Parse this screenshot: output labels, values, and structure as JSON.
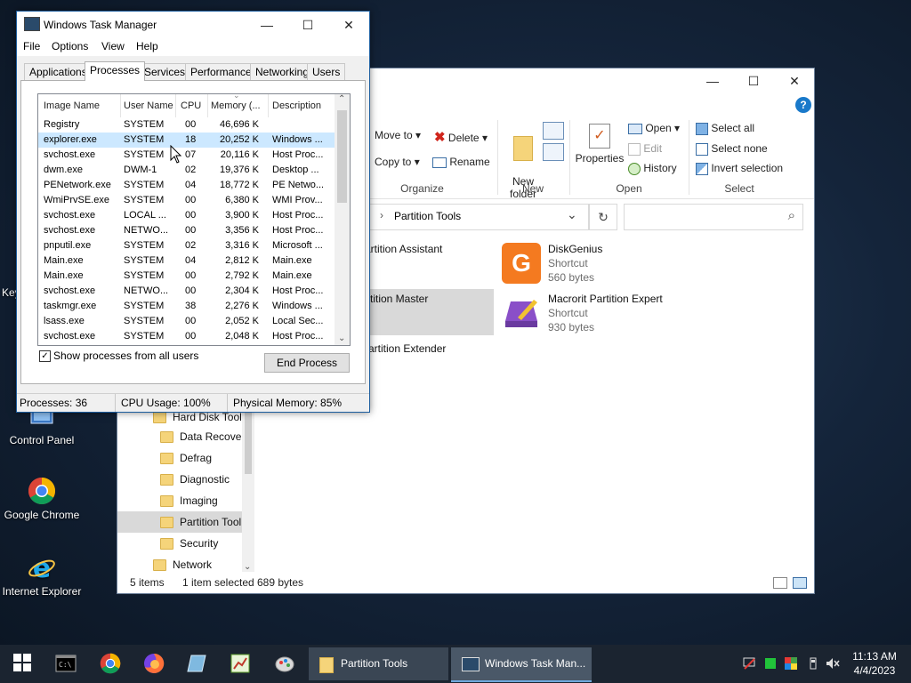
{
  "desktop": {
    "partial_label": "Key",
    "icons": [
      {
        "label": "Control Panel",
        "icon": "control-panel-icon"
      },
      {
        "label": "Google Chrome",
        "icon": "chrome-icon"
      },
      {
        "label": "Internet Explorer",
        "icon": "internet-explorer-icon"
      }
    ]
  },
  "explorer": {
    "window_controls": {
      "minimize": "—",
      "maximize": "☐",
      "close": "✕"
    },
    "ribbon": {
      "organize": {
        "move_to": "Move to ▾",
        "delete": "Delete ▾",
        "copy_to": "Copy to ▾",
        "rename": "Rename",
        "label": "Organize"
      },
      "new": {
        "new_folder": "New\nfolder",
        "label": "New"
      },
      "open": {
        "properties": "Properties",
        "open": "Open ▾",
        "edit": "Edit",
        "history": "History",
        "label": "Open"
      },
      "select": {
        "select_all": "Select all",
        "select_none": "Select none",
        "invert": "Invert selection",
        "label": "Select"
      }
    },
    "address": {
      "path_sep": "›",
      "path": "Partition Tools",
      "dropdown": "⌄",
      "refresh": "↻"
    },
    "search_icon": "⌕",
    "nav_tree": [
      {
        "label": "Hard Disk Tools",
        "indent": 0,
        "selected": false
      },
      {
        "label": "Data Recover",
        "indent": 1,
        "selected": false
      },
      {
        "label": "Defrag",
        "indent": 1,
        "selected": false
      },
      {
        "label": "Diagnostic",
        "indent": 1,
        "selected": false
      },
      {
        "label": "Imaging",
        "indent": 1,
        "selected": false
      },
      {
        "label": "Partition Tool",
        "indent": 1,
        "selected": true
      },
      {
        "label": "Security",
        "indent": 1,
        "selected": false
      },
      {
        "label": "Network",
        "indent": 0,
        "selected": false
      }
    ],
    "files": [
      {
        "name": "artition Assistant",
        "sub1": "",
        "sub2": ""
      },
      {
        "name": "DiskGenius",
        "sub1": "Shortcut",
        "sub2": "560 bytes"
      },
      {
        "name": "rtition Master",
        "sub1": "",
        "sub2": ""
      },
      {
        "name": "Macrorit Partition Expert",
        "sub1": "Shortcut",
        "sub2": "930 bytes"
      },
      {
        "name": "artition Extender",
        "sub1": "",
        "sub2": ""
      }
    ],
    "status": {
      "items": "5 items",
      "selected": "1 item selected",
      "size": "689 bytes"
    }
  },
  "taskmgr": {
    "title": "Windows Task Manager",
    "window_controls": {
      "minimize": "—",
      "maximize": "☐",
      "close": "✕"
    },
    "menu": [
      "File",
      "Options",
      "View",
      "Help"
    ],
    "tabs": [
      "Applications",
      "Processes",
      "Services",
      "Performance",
      "Networking",
      "Users"
    ],
    "active_tab": "Processes",
    "columns": [
      "Image Name",
      "User Name",
      "CPU",
      "Memory (...",
      "Description"
    ],
    "rows": [
      [
        "Registry",
        "SYSTEM",
        "00",
        "46,696 K",
        ""
      ],
      [
        "explorer.exe",
        "SYSTEM",
        "18",
        "20,252 K",
        "Windows ..."
      ],
      [
        "svchost.exe",
        "SYSTEM",
        "07",
        "20,116 K",
        "Host Proc..."
      ],
      [
        "dwm.exe",
        "DWM-1",
        "02",
        "19,376 K",
        "Desktop ..."
      ],
      [
        "PENetwork.exe",
        "SYSTEM",
        "04",
        "18,772 K",
        "PE Netwo..."
      ],
      [
        "WmiPrvSE.exe",
        "SYSTEM",
        "00",
        "6,380 K",
        "WMI Prov..."
      ],
      [
        "svchost.exe",
        "LOCAL ...",
        "00",
        "3,900 K",
        "Host Proc..."
      ],
      [
        "svchost.exe",
        "NETWO...",
        "00",
        "3,356 K",
        "Host Proc..."
      ],
      [
        "pnputil.exe",
        "SYSTEM",
        "02",
        "3,316 K",
        "Microsoft ..."
      ],
      [
        "Main.exe",
        "SYSTEM",
        "04",
        "2,812 K",
        "Main.exe"
      ],
      [
        "Main.exe",
        "SYSTEM",
        "00",
        "2,792 K",
        "Main.exe"
      ],
      [
        "svchost.exe",
        "NETWO...",
        "00",
        "2,304 K",
        "Host Proc..."
      ],
      [
        "taskmgr.exe",
        "SYSTEM",
        "38",
        "2,276 K",
        "Windows ..."
      ],
      [
        "lsass.exe",
        "SYSTEM",
        "00",
        "2,052 K",
        "Local Sec..."
      ],
      [
        "svchost.exe",
        "SYSTEM",
        "00",
        "2,048 K",
        "Host Proc..."
      ]
    ],
    "selected_row": 1,
    "show_all_label": "Show processes from all users",
    "show_all_checked": "✓",
    "end_process": "End Process",
    "scroll": {
      "up": "⌃",
      "down": "⌄",
      "sort": "⌄"
    },
    "status": {
      "processes": "Processes: 36",
      "cpu": "CPU Usage: 100%",
      "memory": "Physical Memory: 85%"
    }
  },
  "taskbar": {
    "tasks": [
      {
        "label": "Partition Tools",
        "icon": "folder-icon"
      },
      {
        "label": "Windows Task Man...",
        "icon": "task-manager-icon"
      }
    ],
    "clock": {
      "time": "11:13 AM",
      "date": "4/4/2023"
    },
    "colors": {
      "accent": "#1979ca",
      "taskbar": "#1b2430"
    }
  }
}
